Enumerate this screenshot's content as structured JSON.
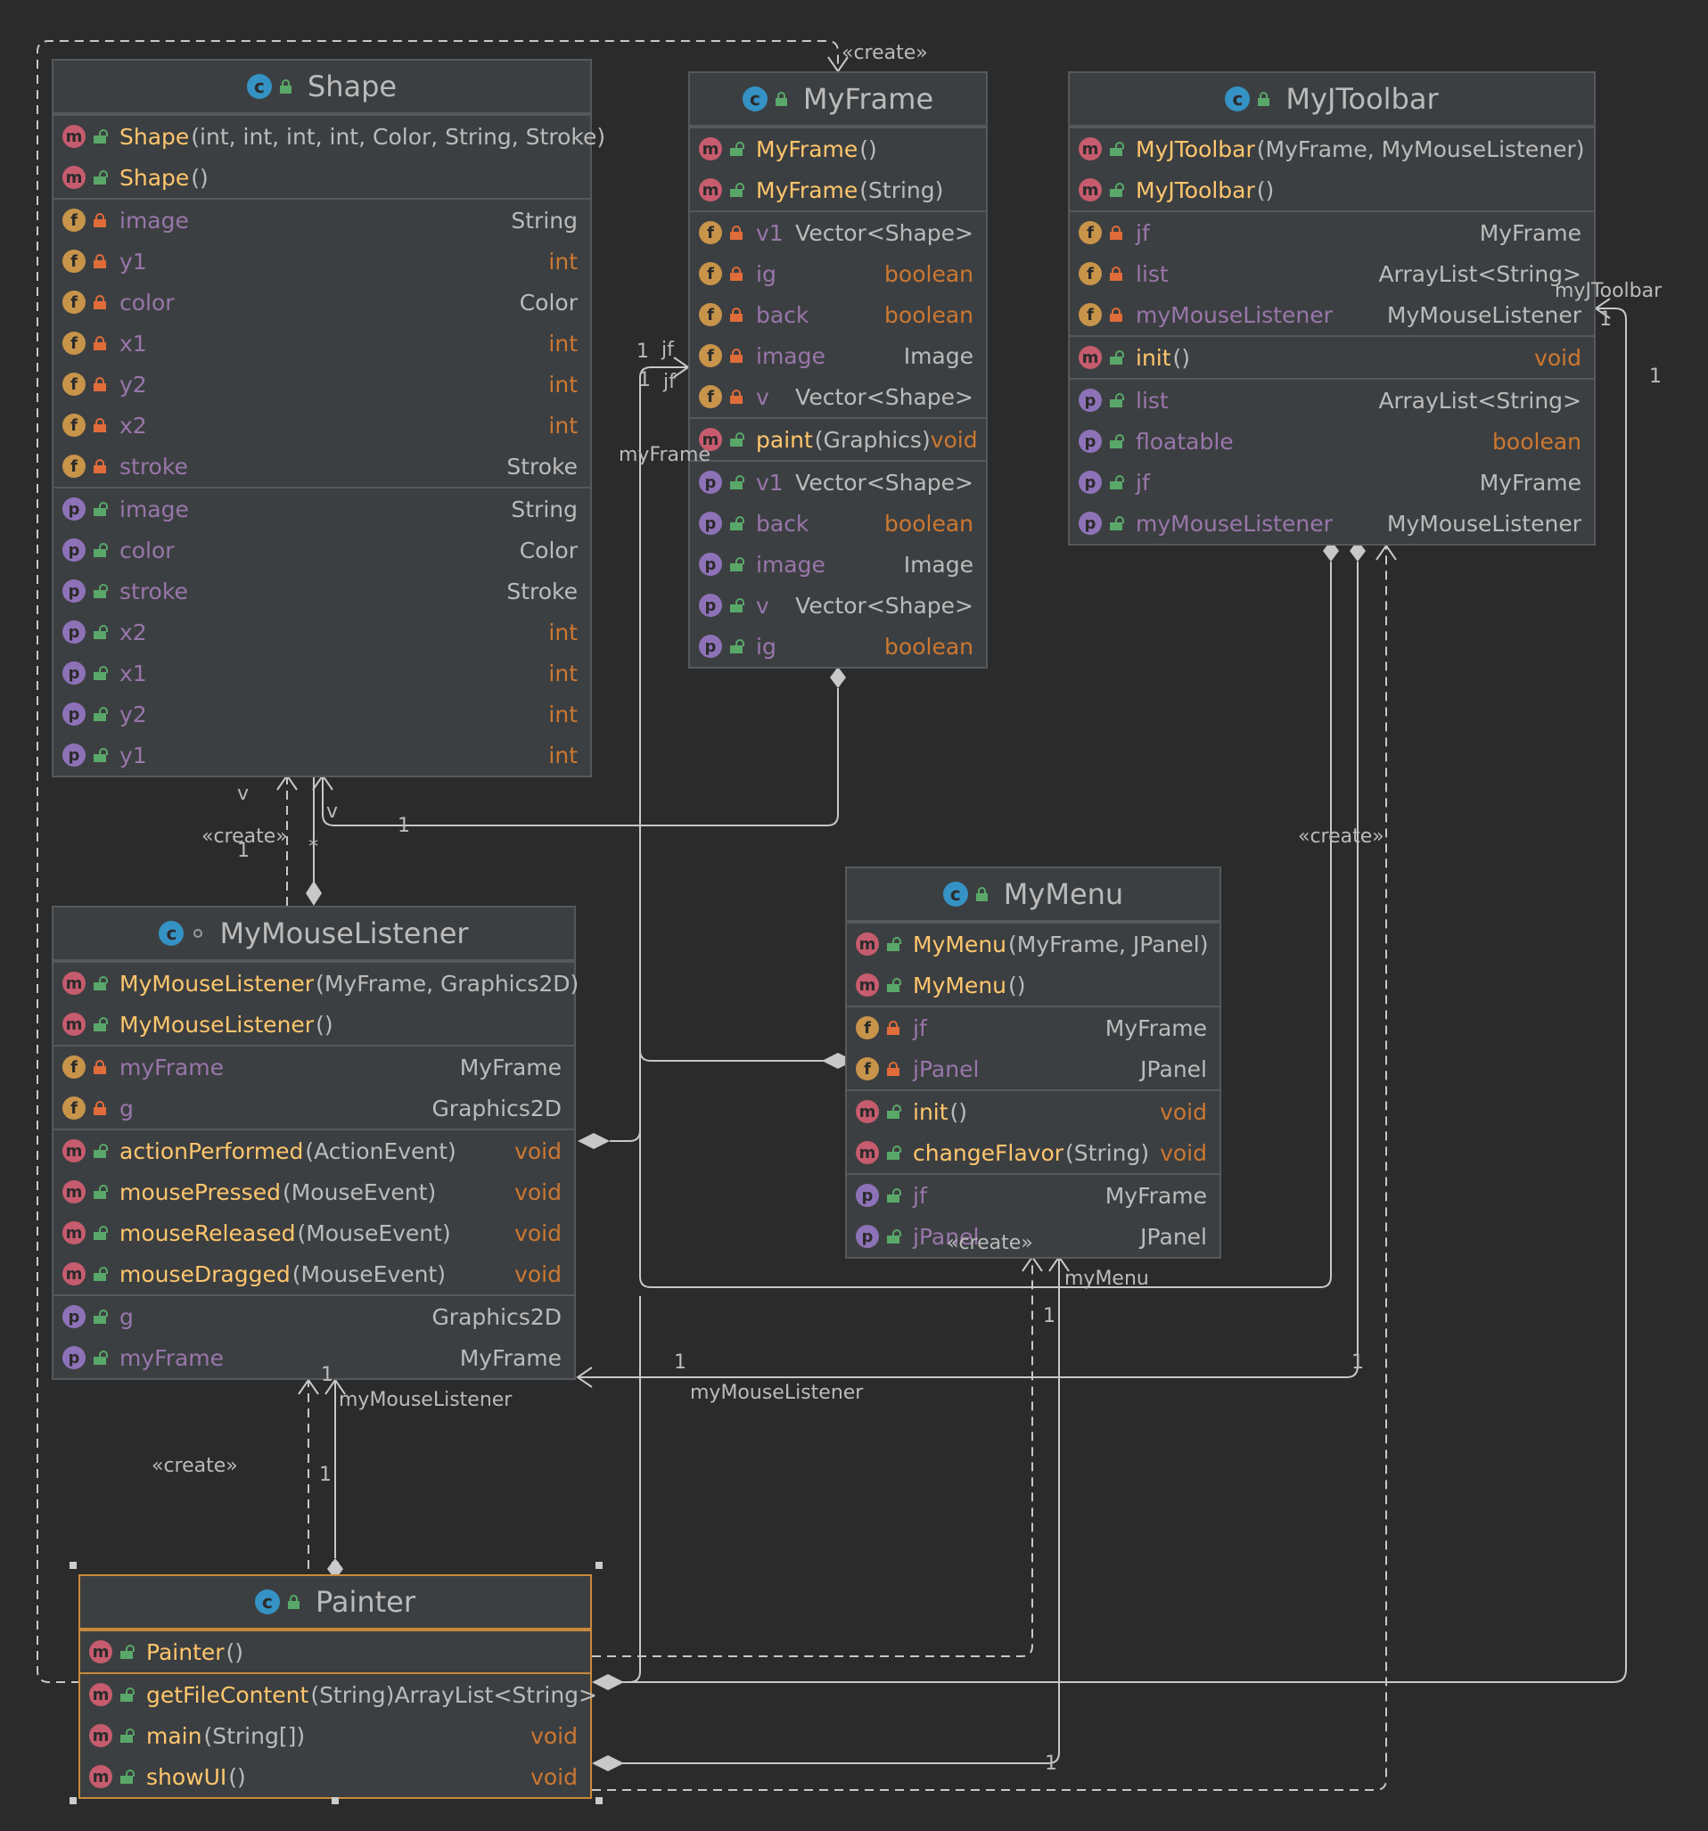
{
  "classes": {
    "shape": {
      "name": "Shape",
      "constructors": [
        {
          "name": "Shape",
          "sig": "(int, int, int, int, Color, String, Stroke)"
        },
        {
          "name": "Shape",
          "sig": "()"
        }
      ],
      "fields": [
        {
          "name": "image",
          "type": "String"
        },
        {
          "name": "y1",
          "type": "int"
        },
        {
          "name": "color",
          "type": "Color"
        },
        {
          "name": "x1",
          "type": "int"
        },
        {
          "name": "y2",
          "type": "int"
        },
        {
          "name": "x2",
          "type": "int"
        },
        {
          "name": "stroke",
          "type": "Stroke"
        }
      ],
      "properties": [
        {
          "name": "image",
          "type": "String"
        },
        {
          "name": "color",
          "type": "Color"
        },
        {
          "name": "stroke",
          "type": "Stroke"
        },
        {
          "name": "x2",
          "type": "int"
        },
        {
          "name": "x1",
          "type": "int"
        },
        {
          "name": "y2",
          "type": "int"
        },
        {
          "name": "y1",
          "type": "int"
        }
      ]
    },
    "myframe": {
      "name": "MyFrame",
      "constructors": [
        {
          "name": "MyFrame",
          "sig": "()"
        },
        {
          "name": "MyFrame",
          "sig": "(String)"
        }
      ],
      "fields": [
        {
          "name": "v1",
          "type": "Vector<Shape>"
        },
        {
          "name": "ig",
          "type": "boolean"
        },
        {
          "name": "back",
          "type": "boolean"
        },
        {
          "name": "image",
          "type": "Image"
        },
        {
          "name": "v",
          "type": "Vector<Shape>"
        }
      ],
      "methods": [
        {
          "name": "paint",
          "sig": "(Graphics)",
          "type": "void"
        }
      ],
      "properties": [
        {
          "name": "v1",
          "type": "Vector<Shape>"
        },
        {
          "name": "back",
          "type": "boolean"
        },
        {
          "name": "image",
          "type": "Image"
        },
        {
          "name": "v",
          "type": "Vector<Shape>"
        },
        {
          "name": "ig",
          "type": "boolean"
        }
      ]
    },
    "myjtoolbar": {
      "name": "MyJToolbar",
      "constructors": [
        {
          "name": "MyJToolbar",
          "sig": "(MyFrame, MyMouseListener)"
        },
        {
          "name": "MyJToolbar",
          "sig": "()"
        }
      ],
      "fields": [
        {
          "name": "jf",
          "type": "MyFrame"
        },
        {
          "name": "list",
          "type": "ArrayList<String>"
        },
        {
          "name": "myMouseListener",
          "type": "MyMouseListener"
        }
      ],
      "methods": [
        {
          "name": "init",
          "sig": "()",
          "type": "void"
        }
      ],
      "properties": [
        {
          "name": "list",
          "type": "ArrayList<String>"
        },
        {
          "name": "floatable",
          "type": "boolean"
        },
        {
          "name": "jf",
          "type": "MyFrame"
        },
        {
          "name": "myMouseListener",
          "type": "MyMouseListener"
        }
      ]
    },
    "mymouselistener": {
      "name": "MyMouseListener",
      "constructors": [
        {
          "name": "MyMouseListener",
          "sig": "(MyFrame, Graphics2D)"
        },
        {
          "name": "MyMouseListener",
          "sig": "()"
        }
      ],
      "fields": [
        {
          "name": "myFrame",
          "type": "MyFrame"
        },
        {
          "name": "g",
          "type": "Graphics2D"
        }
      ],
      "methods": [
        {
          "name": "actionPerformed",
          "sig": "(ActionEvent)",
          "type": "void"
        },
        {
          "name": "mousePressed",
          "sig": "(MouseEvent)",
          "type": "void"
        },
        {
          "name": "mouseReleased",
          "sig": "(MouseEvent)",
          "type": "void"
        },
        {
          "name": "mouseDragged",
          "sig": "(MouseEvent)",
          "type": "void"
        }
      ],
      "properties": [
        {
          "name": "g",
          "type": "Graphics2D"
        },
        {
          "name": "myFrame",
          "type": "MyFrame"
        }
      ]
    },
    "mymenu": {
      "name": "MyMenu",
      "constructors": [
        {
          "name": "MyMenu",
          "sig": "(MyFrame, JPanel)"
        },
        {
          "name": "MyMenu",
          "sig": "()"
        }
      ],
      "fields": [
        {
          "name": "jf",
          "type": "MyFrame"
        },
        {
          "name": "jPanel",
          "type": "JPanel"
        }
      ],
      "methods": [
        {
          "name": "init",
          "sig": "()",
          "type": "void"
        },
        {
          "name": "changeFlavor",
          "sig": "(String)",
          "type": "void"
        }
      ],
      "properties": [
        {
          "name": "jf",
          "type": "MyFrame"
        },
        {
          "name": "jPanel",
          "type": "JPanel"
        }
      ]
    },
    "painter": {
      "name": "Painter",
      "constructors": [
        {
          "name": "Painter",
          "sig": "()"
        }
      ],
      "methods": [
        {
          "name": "getFileContent",
          "sig": "(String)",
          "type": "ArrayList<String>"
        },
        {
          "name": "main",
          "sig": "(String[])",
          "type": "void"
        },
        {
          "name": "showUI",
          "sig": "()",
          "type": "void"
        }
      ]
    }
  },
  "labels": {
    "create": "«create»",
    "v": "v",
    "one": "1",
    "star": "*",
    "jf": "jf",
    "myFrame": "myFrame",
    "myJToolbar": "myJToolbar",
    "myMenu": "myMenu",
    "myMouseListener": "myMouseListener"
  },
  "colors": {
    "background": "#2b2b2b",
    "box": "#3c3f41",
    "border": "#55595c",
    "selected_border": "#c9893a",
    "method_name": "#ffc66d",
    "field_name": "#9876aa",
    "keyword_type": "#cc7832",
    "text": "#bbbbbb",
    "class_icon": "#3592c4"
  }
}
